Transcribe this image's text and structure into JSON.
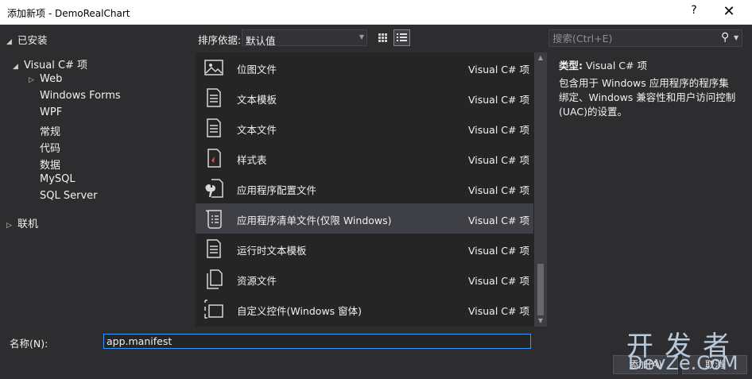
{
  "window": {
    "title": "添加新项 - DemoRealChart",
    "help": "?",
    "close": "✕"
  },
  "tree": {
    "installed_label": "已安装",
    "items": [
      {
        "label": "Visual C# 项"
      },
      {
        "label": "Web"
      },
      {
        "label": "Windows Forms"
      },
      {
        "label": "WPF"
      },
      {
        "label": "常规"
      },
      {
        "label": "代码"
      },
      {
        "label": "数据"
      },
      {
        "label": "MySQL"
      },
      {
        "label": "SQL Server"
      },
      {
        "label": "联机"
      }
    ]
  },
  "toolbar": {
    "sort_label": "排序依据:",
    "sort_value": "默认值"
  },
  "search": {
    "placeholder": "搜索(Ctrl+E)"
  },
  "templates": [
    {
      "name": "位图文件",
      "lang": "Visual C# 项",
      "icon": "image-icon"
    },
    {
      "name": "文本模板",
      "lang": "Visual C# 项",
      "icon": "text-file-icon"
    },
    {
      "name": "文本文件",
      "lang": "Visual C# 项",
      "icon": "text-file-icon"
    },
    {
      "name": "样式表",
      "lang": "Visual C# 项",
      "icon": "stylesheet-icon"
    },
    {
      "name": "应用程序配置文件",
      "lang": "Visual C# 项",
      "icon": "config-file-icon"
    },
    {
      "name": "应用程序清单文件(仅限 Windows)",
      "lang": "Visual C# 项",
      "icon": "manifest-icon"
    },
    {
      "name": "运行时文本模板",
      "lang": "Visual C# 项",
      "icon": "text-file-icon"
    },
    {
      "name": "资源文件",
      "lang": "Visual C# 项",
      "icon": "resource-file-icon"
    },
    {
      "name": "自定义控件(Windows 窗体)",
      "lang": "Visual C# 项",
      "icon": "custom-control-icon"
    }
  ],
  "description": {
    "type_label": "类型:",
    "type_value": "Visual C# 项",
    "text": "包含用于 Windows 应用程序的程序集绑定、Windows 兼容性和用户访问控制(UAC)的设置。"
  },
  "name_field": {
    "label": "名称(N):",
    "value": "app.manifest"
  },
  "buttons": {
    "add": "添加(A)",
    "cancel": "取消"
  },
  "watermark": {
    "cn": "开发者",
    "en": "DevZe.CoM"
  },
  "colors": {
    "accent": "#3399ff",
    "background": "#2d2d30",
    "list_bg": "#252526",
    "selected": "#3f3f46"
  }
}
